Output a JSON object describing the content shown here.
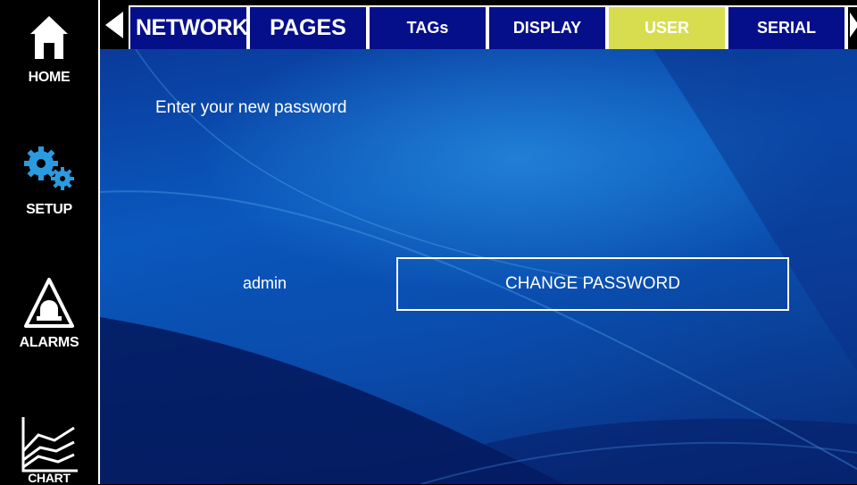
{
  "sidebar": {
    "items": [
      {
        "label": "HOME",
        "icon": "home-icon"
      },
      {
        "label": "SETUP",
        "icon": "gears-icon"
      },
      {
        "label": "ALARMS",
        "icon": "alarm-beacon-icon"
      },
      {
        "label": "CHART",
        "icon": "chart-icon"
      }
    ]
  },
  "tabs": {
    "items": [
      {
        "label": "NETWORK"
      },
      {
        "label": "PAGES"
      },
      {
        "label": "TAGs"
      },
      {
        "label": "DISPLAY"
      },
      {
        "label": "USER",
        "active": true
      },
      {
        "label": "SERIAL"
      }
    ],
    "prev_icon": "triangle-left-icon",
    "next_icon": "triangle-right-icon"
  },
  "main": {
    "prompt": "Enter your new password",
    "username": "admin",
    "change_password_label": "CHANGE PASSWORD"
  },
  "colors": {
    "tab_background": "#060f8a",
    "active_tab": "#d8dd50",
    "sidebar_background": "#000000",
    "setup_icon": "#2a9be0"
  }
}
